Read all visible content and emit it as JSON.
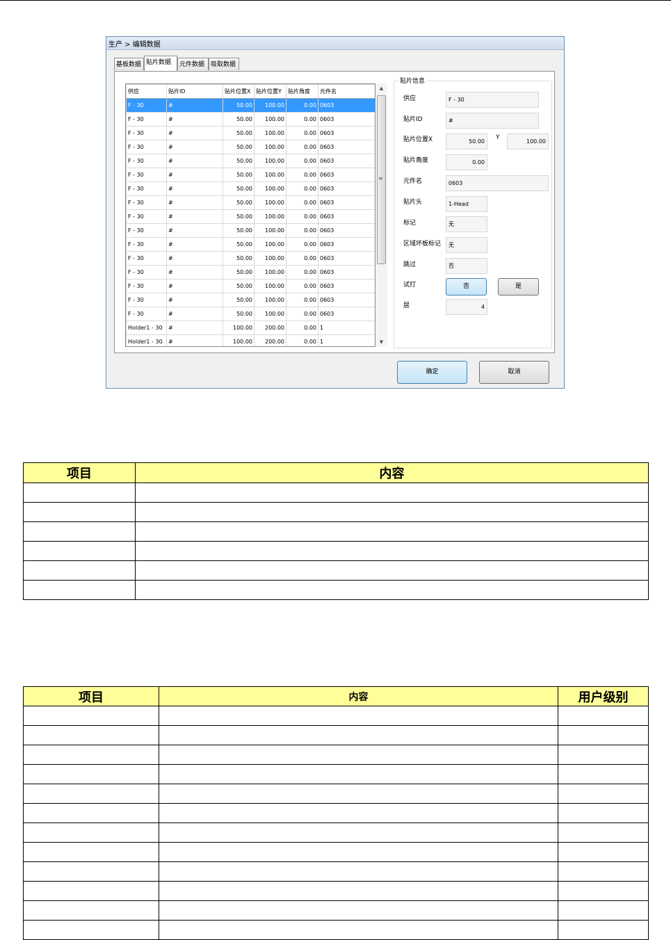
{
  "dialog": {
    "title": "生产 > 编辑数据",
    "tabs": [
      "基板数据",
      "贴片数据",
      "元件数据",
      "吸取数据"
    ],
    "active_tab": 1,
    "grid": {
      "columns": [
        "供应",
        "贴片ID",
        "贴片位置X",
        "贴片位置Y",
        "贴片角度",
        "元件名"
      ],
      "rows": [
        [
          "F - 30",
          "#",
          "50.00",
          "100.00",
          "0.00",
          "0603"
        ],
        [
          "F - 30",
          "#",
          "50.00",
          "100.00",
          "0.00",
          "0603"
        ],
        [
          "F - 30",
          "#",
          "50.00",
          "100.00",
          "0.00",
          "0603"
        ],
        [
          "F - 30",
          "#",
          "50.00",
          "100.00",
          "0.00",
          "0603"
        ],
        [
          "F - 30",
          "#",
          "50.00",
          "100.00",
          "0.00",
          "0603"
        ],
        [
          "F - 30",
          "#",
          "50.00",
          "100.00",
          "0.00",
          "0603"
        ],
        [
          "F - 30",
          "#",
          "50.00",
          "100.00",
          "0.00",
          "0603"
        ],
        [
          "F - 30",
          "#",
          "50.00",
          "100.00",
          "0.00",
          "0603"
        ],
        [
          "F - 30",
          "#",
          "50.00",
          "100.00",
          "0.00",
          "0603"
        ],
        [
          "F - 30",
          "#",
          "50.00",
          "100.00",
          "0.00",
          "0603"
        ],
        [
          "F - 30",
          "#",
          "50.00",
          "100.00",
          "0.00",
          "0603"
        ],
        [
          "F - 30",
          "#",
          "50.00",
          "100.00",
          "0.00",
          "0603"
        ],
        [
          "F - 30",
          "#",
          "50.00",
          "100.00",
          "0.00",
          "0603"
        ],
        [
          "F - 30",
          "#",
          "50.00",
          "100.00",
          "0.00",
          "0603"
        ],
        [
          "F - 30",
          "#",
          "50.00",
          "100.00",
          "0.00",
          "0603"
        ],
        [
          "F - 30",
          "#",
          "50.00",
          "100.00",
          "0.00",
          "0603"
        ],
        [
          "Holder1 - 30",
          "#",
          "100.00",
          "200.00",
          "0.00",
          "1"
        ],
        [
          "Holder1 - 30",
          "#",
          "100.00",
          "200.00",
          "0.00",
          "1"
        ]
      ],
      "selected_row": 0
    },
    "info": {
      "legend": "贴片信息",
      "supply_label": "供应",
      "supply_value": "F - 30",
      "id_label": "贴片ID",
      "id_value": "#",
      "posx_label": "贴片位置X",
      "posx_value": "50.00",
      "y_label": "Y",
      "posy_value": "100.00",
      "angle_label": "贴片角度",
      "angle_value": "0.00",
      "part_label": "元件名",
      "part_value": "0603",
      "head_label": "贴片头",
      "head_value": "1-Head",
      "mark_label": "标记",
      "mark_value": "无",
      "badmark_label": "区域坏板标记",
      "badmark_value": "无",
      "skip_label": "跳过",
      "skip_value": "否",
      "trial_label": "试打",
      "trial_no": "否",
      "trial_yes": "是",
      "layer_label": "层",
      "layer_value": "4"
    },
    "ok_label": "确定",
    "cancel_label": "取消"
  },
  "table1": {
    "headers": [
      "项目",
      "内容"
    ],
    "empty_rows": 6
  },
  "table2": {
    "headers": [
      "项目",
      "内容",
      "用户级别"
    ],
    "empty_rows": 12
  }
}
